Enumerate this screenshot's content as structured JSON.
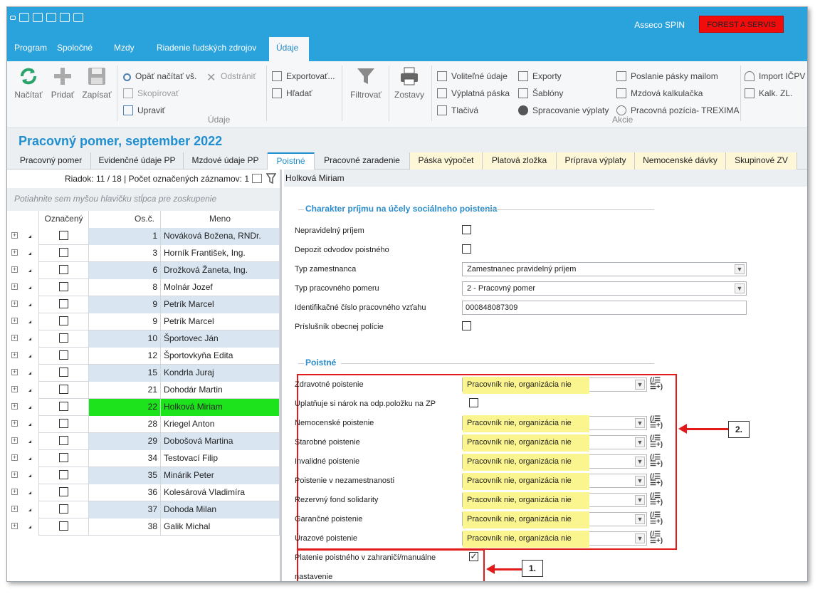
{
  "window": {
    "app_name": "Asseco SPIN",
    "separator": "-",
    "company": "FOREST A SERVIS"
  },
  "menu": [
    "Program",
    "Spoločné",
    "Mzdy",
    "Riadenie ľudských zdrojov",
    "Údaje"
  ],
  "ribbon": {
    "load": "Načítať",
    "add": "Pridať",
    "save": "Zapísať",
    "reload_all": "Opäť načítať vš.",
    "delete": "Odstrániť",
    "copy": "Skopírovať",
    "edit": "Upraviť",
    "export": "Exportovať...",
    "search": "Hľadať",
    "group_udaje": "Údaje",
    "filter": "Filtrovať",
    "reports": "Zostavy",
    "optional_data": "Voliteľné údaje",
    "payslip": "Výplatná páska",
    "print_forms": "Tlačivá",
    "exports": "Exporty",
    "templates": "Šablóny",
    "payroll_processing": "Spracovanie výplaty",
    "send_payslip": "Poslanie pásky mailom",
    "calculator": "Mzdová kalkulačka",
    "position": "Pracovná pozícia- TREXIMA",
    "import": "Import IČPV",
    "kalk": "Kalk. ZL.",
    "group_akcie": "Akcie"
  },
  "page_title": "Pracovný pomer, september 2022",
  "tabs": [
    "Pracovný pomer",
    "Evidenčné údaje PP",
    "Mzdové údaje PP",
    "Poistné",
    "Pracovné zaradenie",
    "Páska výpočet",
    "Platová zložka",
    "Príprava výplaty",
    "Nemocenské dávky",
    "Skupinové ZV"
  ],
  "left": {
    "row_info": "Riadok: 11 / 18 | Počet označených záznamov: 1",
    "group_hint": "Potiahnite sem myšou hlavičku stĺpca pre zoskupenie",
    "columns": [
      "Označený",
      "Os.č.",
      "Meno"
    ],
    "rows": [
      {
        "os": "1",
        "meno": "Nováková Božena, RNDr."
      },
      {
        "os": "3",
        "meno": "Horník František, Ing."
      },
      {
        "os": "6",
        "meno": "Drožková Žaneta, Ing."
      },
      {
        "os": "8",
        "meno": "Molnár Jozef"
      },
      {
        "os": "9",
        "meno": "Petrík Marcel"
      },
      {
        "os": "9",
        "meno": "Petrík Marcel"
      },
      {
        "os": "10",
        "meno": "Športovec Ján"
      },
      {
        "os": "12",
        "meno": "Športovkyňa Edita"
      },
      {
        "os": "15",
        "meno": "Kondrla Juraj"
      },
      {
        "os": "21",
        "meno": "Dohodár Martin"
      },
      {
        "os": "22",
        "meno": "Holková Miriam"
      },
      {
        "os": "28",
        "meno": "Kriegel Anton"
      },
      {
        "os": "29",
        "meno": "Dobošová Martina"
      },
      {
        "os": "34",
        "meno": "Testovací Filip"
      },
      {
        "os": "35",
        "meno": "Minárik Peter"
      },
      {
        "os": "36",
        "meno": "Kolesárová Vladimíra"
      },
      {
        "os": "37",
        "meno": "Dohoda Milan"
      },
      {
        "os": "38",
        "meno": "Galik Michal"
      }
    ]
  },
  "right": {
    "employee": "Holková Miriam",
    "section1": "Charakter príjmu na účely sociálneho poistenia",
    "nepravidelny": "Nepravidelný príjem",
    "depozit": "Depozit odvodov poistného",
    "typ_zam_label": "Typ zamestnanca",
    "typ_zam_value": "Zamestnanec pravidelný príjem",
    "typ_pp_label": "Typ pracovného pomeru",
    "typ_pp_value": "2 - Pracovný pomer",
    "icpv_label": "Identifikačné číslo pracovného vzťahu",
    "icpv_value": "000848087309",
    "policia": "Príslušník obecnej polície",
    "section2": "Poistné",
    "zdravotne": "Zdravotné poistenie",
    "uplatnuje": "Uplatňuje si nárok na odp.položku na ZP",
    "nemocenske": "Nemocenské poistenie",
    "starobne": "Starobné poistenie",
    "invalidne": "Invalidné poistenie",
    "nezam": "Poistenie v nezamestnanosti",
    "rezerv": "Rezervný fond solidarity",
    "garancne": "Garančné poistenie",
    "urazove": "Úrazové poistenie",
    "value": "Pracovník nie, organizácia nie",
    "zahranicie_1": "Platenie poistného v zahraničí/manuálne",
    "zahranicie_2": "nastavenie",
    "callout1": "1.",
    "callout2": "2."
  },
  "colors": {
    "accent": "#2aa3dc",
    "company_bg": "#f20d0d",
    "selected_row": "#1de31d",
    "highlight": "#fbf58f",
    "callout_red": "#e21a1a"
  }
}
